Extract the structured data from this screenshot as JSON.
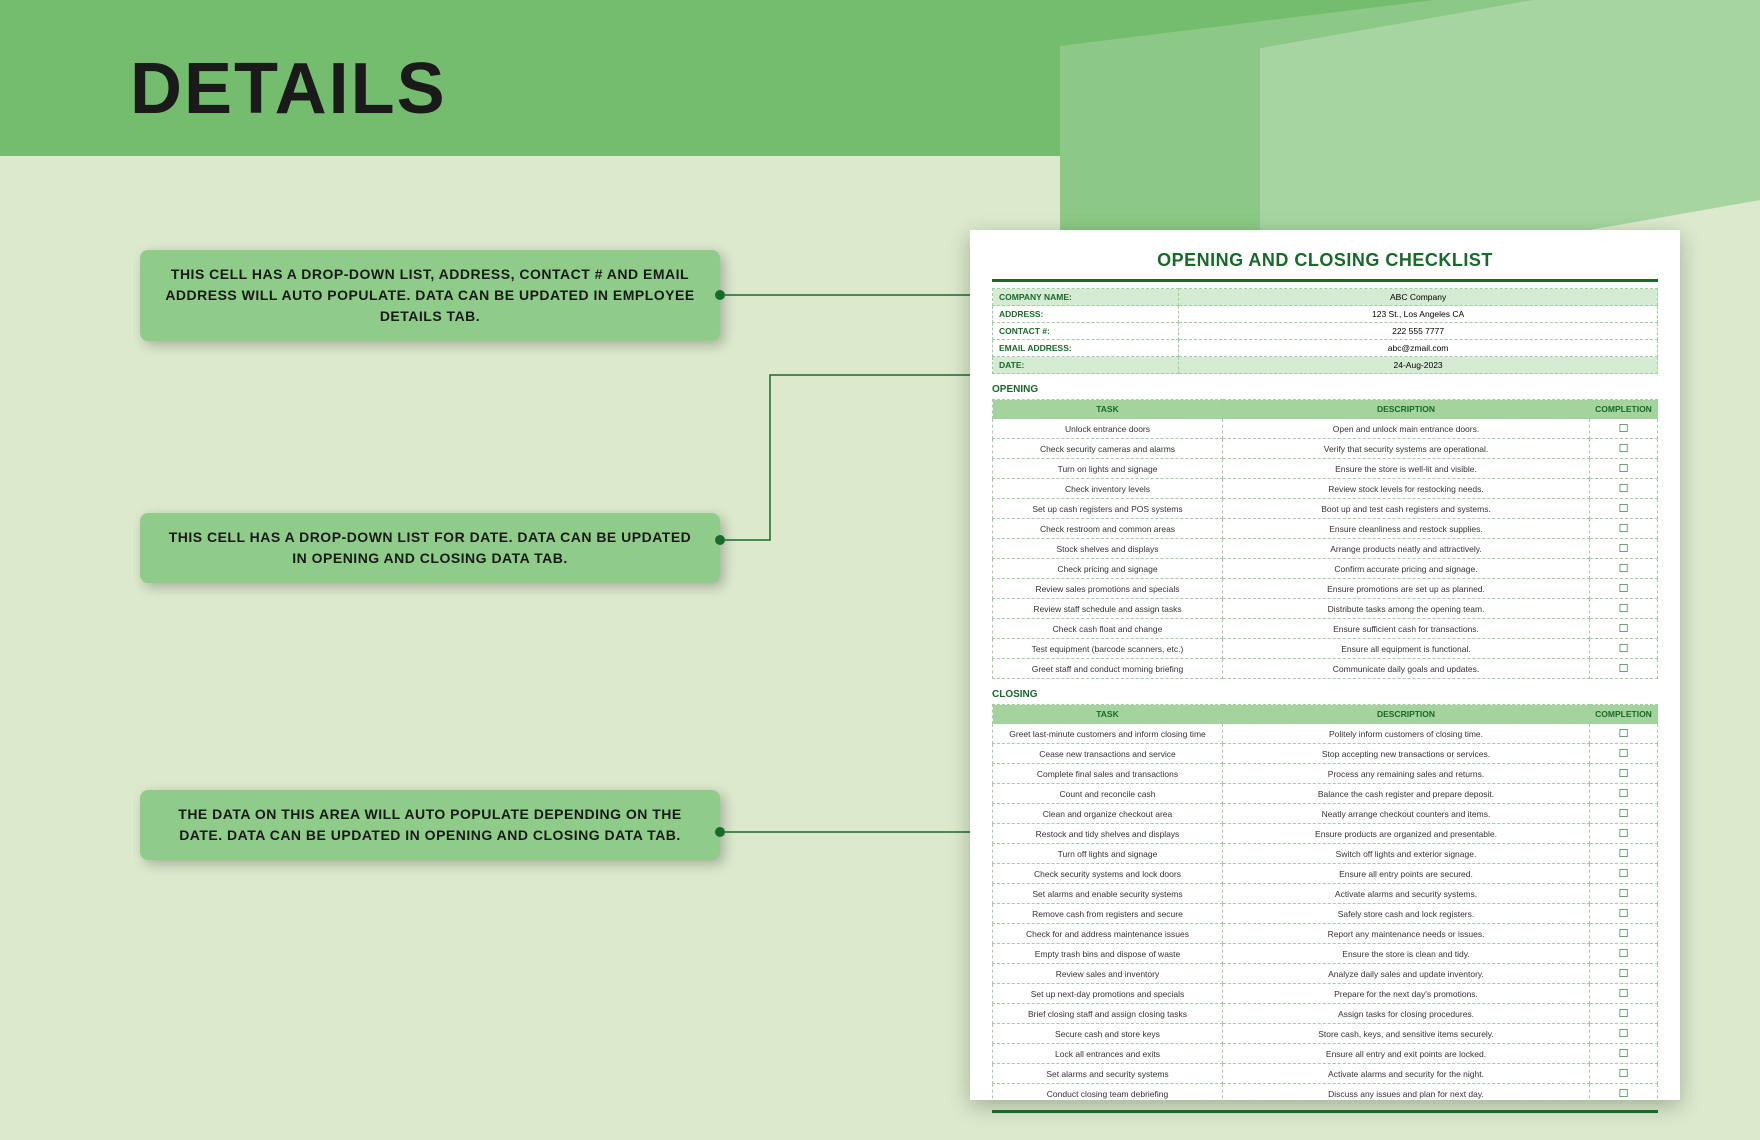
{
  "page": {
    "title": "DETAILS"
  },
  "callouts": {
    "c1": "THIS CELL HAS A DROP-DOWN LIST, ADDRESS, CONTACT # AND EMAIL ADDRESS WILL AUTO POPULATE. DATA CAN BE UPDATED IN EMPLOYEE DETAILS TAB.",
    "c2": "THIS CELL HAS A DROP-DOWN LIST FOR DATE. DATA CAN BE UPDATED IN OPENING AND CLOSING DATA TAB.",
    "c3": "THE DATA ON THIS AREA WILL AUTO POPULATE DEPENDING ON THE DATE. DATA CAN BE UPDATED IN OPENING AND CLOSING DATA TAB."
  },
  "sheet": {
    "title": "OPENING AND CLOSING CHECKLIST",
    "info": {
      "company_label": "COMPANY NAME:",
      "company_value": "ABC Company",
      "address_label": "ADDRESS:",
      "address_value": "123 St., Los Angeles CA",
      "contact_label": "CONTACT #:",
      "contact_value": "222 555 7777",
      "email_label": "EMAIL ADDRESS:",
      "email_value": "abc@zmail.com",
      "date_label": "DATE:",
      "date_value": "24-Aug-2023"
    },
    "section_opening": "OPENING",
    "section_closing": "CLOSING",
    "headers": {
      "task": "TASK",
      "description": "DESCRIPTION",
      "completion": "COMPLETION"
    },
    "opening": [
      {
        "task": "Unlock entrance doors",
        "desc": "Open and unlock main entrance doors."
      },
      {
        "task": "Check security cameras and alarms",
        "desc": "Verify that security systems are operational."
      },
      {
        "task": "Turn on lights and signage",
        "desc": "Ensure the store is well-lit and visible."
      },
      {
        "task": "Check inventory levels",
        "desc": "Review stock levels for restocking needs."
      },
      {
        "task": "Set up cash registers and POS systems",
        "desc": "Boot up and test cash registers and systems."
      },
      {
        "task": "Check restroom and common areas",
        "desc": "Ensure cleanliness and restock supplies."
      },
      {
        "task": "Stock shelves and displays",
        "desc": "Arrange products neatly and attractively."
      },
      {
        "task": "Check pricing and signage",
        "desc": "Confirm accurate pricing and signage."
      },
      {
        "task": "Review sales promotions and specials",
        "desc": "Ensure promotions are set up as planned."
      },
      {
        "task": "Review staff schedule and assign tasks",
        "desc": "Distribute tasks among the opening team."
      },
      {
        "task": "Check cash float and change",
        "desc": "Ensure sufficient cash for transactions."
      },
      {
        "task": "Test equipment (barcode scanners, etc.)",
        "desc": "Ensure all equipment is functional."
      },
      {
        "task": "Greet staff and conduct morning briefing",
        "desc": "Communicate daily goals and updates."
      }
    ],
    "closing": [
      {
        "task": "Greet last-minute customers and inform closing time",
        "desc": "Politely inform customers of closing time."
      },
      {
        "task": "Cease new transactions and service",
        "desc": "Stop accepting new transactions or services."
      },
      {
        "task": "Complete final sales and transactions",
        "desc": "Process any remaining sales and returns."
      },
      {
        "task": "Count and reconcile cash",
        "desc": "Balance the cash register and prepare deposit."
      },
      {
        "task": "Clean and organize checkout area",
        "desc": "Neatly arrange checkout counters and items."
      },
      {
        "task": "Restock and tidy shelves and displays",
        "desc": "Ensure products are organized and presentable."
      },
      {
        "task": "Turn off lights and signage",
        "desc": "Switch off lights and exterior signage."
      },
      {
        "task": "Check security systems and lock doors",
        "desc": "Ensure all entry points are secured."
      },
      {
        "task": "Set alarms and enable security systems",
        "desc": "Activate alarms and security systems."
      },
      {
        "task": "Remove cash from registers and secure",
        "desc": "Safely store cash and lock registers."
      },
      {
        "task": "Check for and address maintenance issues",
        "desc": "Report any maintenance needs or issues."
      },
      {
        "task": "Empty trash bins and dispose of waste",
        "desc": "Ensure the store is clean and tidy."
      },
      {
        "task": "Review sales and inventory",
        "desc": "Analyze daily sales and update inventory."
      },
      {
        "task": "Set up next-day promotions and specials",
        "desc": "Prepare for the next day's promotions."
      },
      {
        "task": "Brief closing staff and assign closing tasks",
        "desc": "Assign tasks for closing procedures."
      },
      {
        "task": "Secure cash and store keys",
        "desc": "Store cash, keys, and sensitive items securely."
      },
      {
        "task": "Lock all entrances and exits",
        "desc": "Ensure all entry and exit points are locked."
      },
      {
        "task": "Set alarms and security systems",
        "desc": "Activate alarms and security for the night."
      },
      {
        "task": "Conduct closing team debriefing",
        "desc": "Discuss any issues and plan for next day."
      }
    ],
    "checkbox": "☐"
  }
}
